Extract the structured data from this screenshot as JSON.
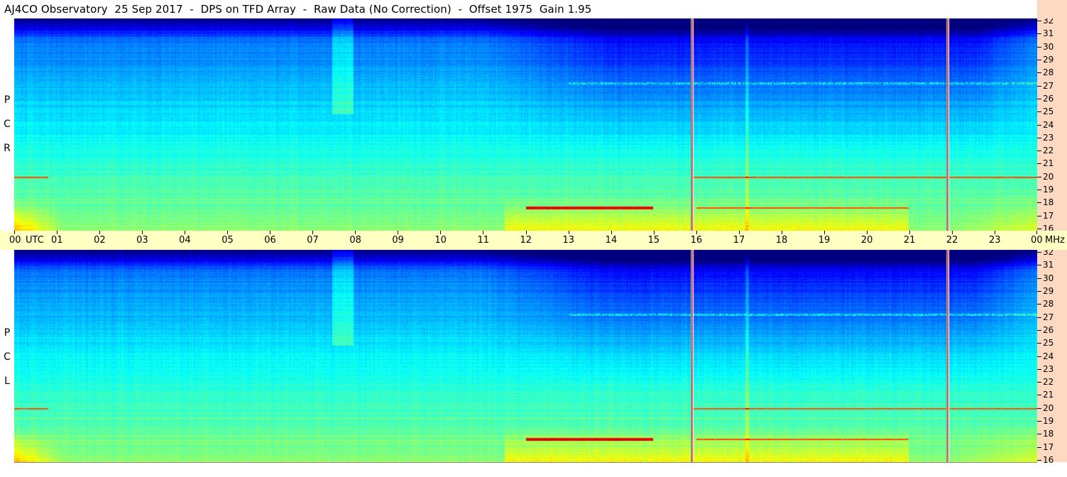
{
  "title": "AJ4CO Observatory  25 Sep 2017  -  DPS on TFD Array  -  Raw Data (No Correction)  -  Offset 1975  Gain 1.95",
  "channels": [
    {
      "name": "RCP",
      "letters": [
        "R",
        "C",
        "P"
      ]
    },
    {
      "name": "LCP",
      "letters": [
        "L",
        "C",
        "P"
      ]
    }
  ],
  "time_unit": "UTC",
  "freq_unit": "MHz",
  "colors": {
    "background": "#ffffff",
    "time_axis_bg": "#ffffc4",
    "freq_axis_bg": "#fcd9c0",
    "interference_line": "#ff4060"
  },
  "chart_data": {
    "type": "heatmap",
    "title": "AJ4CO Observatory  25 Sep 2017  -  DPS on TFD Array  -  Raw Data (No Correction)  -  Offset 1975  Gain 1.95",
    "x_axis": {
      "unit": "UTC",
      "range": [
        0,
        24
      ],
      "tick_labels": [
        "00",
        "01",
        "02",
        "03",
        "04",
        "05",
        "06",
        "07",
        "08",
        "09",
        "10",
        "11",
        "12",
        "13",
        "14",
        "15",
        "16",
        "17",
        "18",
        "19",
        "20",
        "21",
        "22",
        "23",
        "00"
      ]
    },
    "y_axis": {
      "unit": "MHz",
      "range": [
        16,
        32
      ],
      "tick_labels": [
        "32",
        "31",
        "30",
        "29",
        "28",
        "27",
        "26",
        "25",
        "24",
        "23",
        "22",
        "21",
        "20",
        "19",
        "18",
        "17",
        "16"
      ]
    },
    "panels": [
      "RCP",
      "LCP"
    ],
    "colormap": "jet",
    "interference_times_utc": [
      15.9,
      21.9
    ],
    "persistent_freqs_mhz": [
      20.0,
      27.1
    ]
  }
}
